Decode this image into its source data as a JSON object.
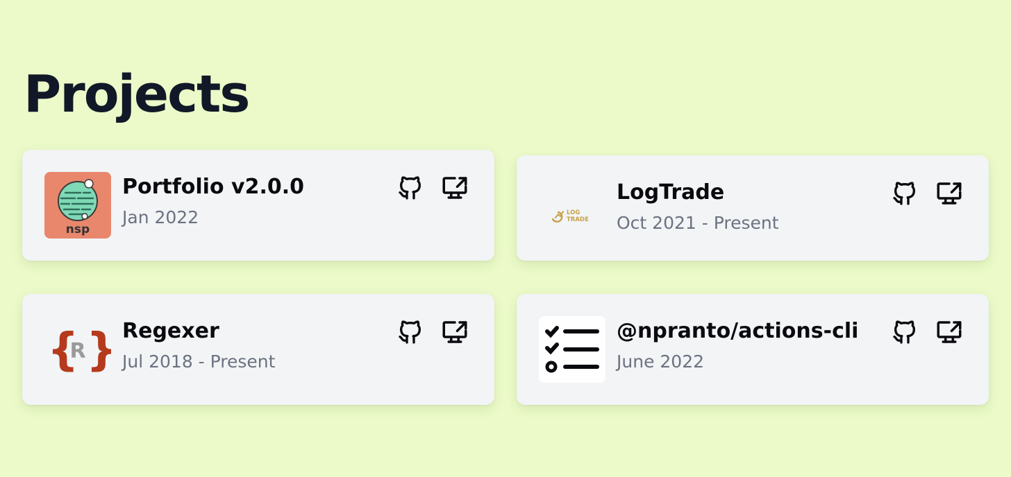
{
  "section": {
    "title": "Projects"
  },
  "projects": [
    {
      "name": "Portfolio v2.0.0",
      "date": "Jan 2022",
      "logo_icon": "nsp-globe-logo",
      "logo_text": "nsp"
    },
    {
      "name": "LogTrade",
      "date": "Oct 2021 - Present",
      "logo_icon": "logtrade-logo",
      "logo_text": "LOG TRADE"
    },
    {
      "name": "Regexer",
      "date": "Jul 2018 - Present",
      "logo_icon": "regexer-logo",
      "logo_text": "R"
    },
    {
      "name": "@npranto/actions-cli",
      "date": "June 2022",
      "logo_icon": "checklist-logo"
    }
  ],
  "icons": {
    "github": "github-icon",
    "external": "external-link-monitor-icon"
  },
  "colors": {
    "background": "#ebfac8",
    "card": "#f2f4f6",
    "title": "#111827",
    "muted": "#6b7280"
  }
}
